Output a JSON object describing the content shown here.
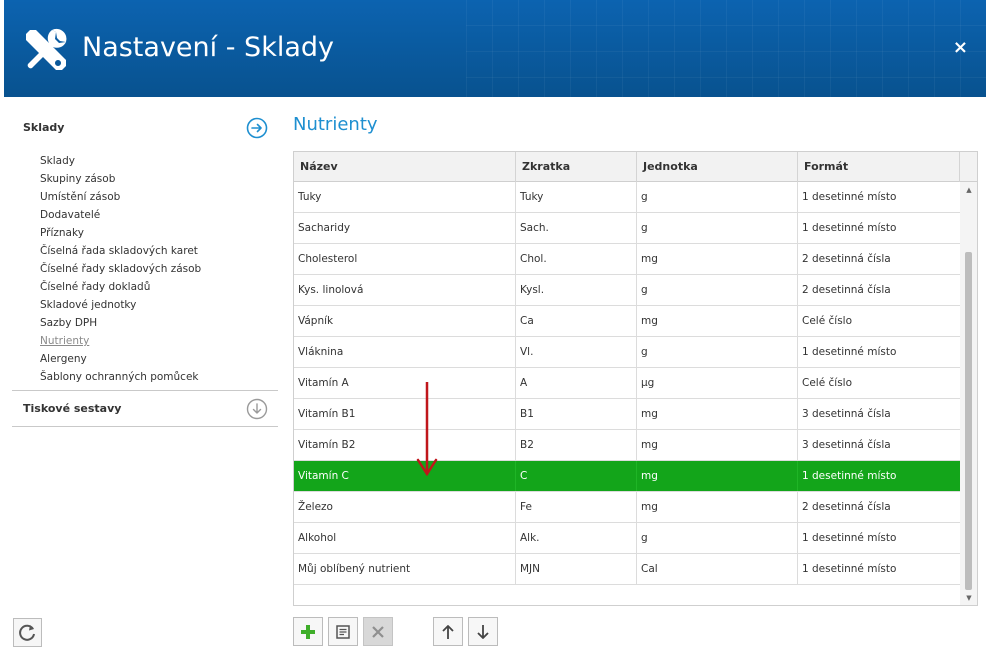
{
  "window": {
    "title": "Nastavení - Sklady",
    "close_label": "×"
  },
  "sidebar": {
    "section1": {
      "label": "Sklady"
    },
    "items": [
      {
        "label": "Sklady"
      },
      {
        "label": "Skupiny zásob"
      },
      {
        "label": "Umístění zásob"
      },
      {
        "label": "Dodavatelé"
      },
      {
        "label": "Příznaky"
      },
      {
        "label": "Číselná řada skladových karet"
      },
      {
        "label": "Číselné řady skladových zásob"
      },
      {
        "label": "Číselné řady dokladů"
      },
      {
        "label": "Skladové jednotky"
      },
      {
        "label": "Sazby DPH"
      },
      {
        "label": "Nutrienty",
        "active": true
      },
      {
        "label": "Alergeny"
      },
      {
        "label": "Šablony ochranných pomůcek"
      }
    ],
    "section2": {
      "label": "Tiskové sestavy"
    }
  },
  "main": {
    "title": "Nutrienty",
    "columns": [
      "Název",
      "Zkratka",
      "Jednotka",
      "Formát"
    ],
    "rows": [
      {
        "name": "Tuky",
        "abbr": "Tuky",
        "unit": "g",
        "format": "1 desetinné místo"
      },
      {
        "name": "Sacharidy",
        "abbr": "Sach.",
        "unit": "g",
        "format": "1 desetinné místo"
      },
      {
        "name": "Cholesterol",
        "abbr": "Chol.",
        "unit": "mg",
        "format": "2 desetinná čísla"
      },
      {
        "name": "Kys. linolová",
        "abbr": "Kysl.",
        "unit": "g",
        "format": "2 desetinná čísla"
      },
      {
        "name": "Vápník",
        "abbr": "Ca",
        "unit": "mg",
        "format": "Celé číslo"
      },
      {
        "name": "Vláknina",
        "abbr": "Vl.",
        "unit": "g",
        "format": "1 desetinné místo"
      },
      {
        "name": "Vitamín A",
        "abbr": "A",
        "unit": "μg",
        "format": "Celé číslo"
      },
      {
        "name": "Vitamín B1",
        "abbr": "B1",
        "unit": "mg",
        "format": "3 desetinná čísla"
      },
      {
        "name": "Vitamín B2",
        "abbr": "B2",
        "unit": "mg",
        "format": "3 desetinná čísla"
      },
      {
        "name": "Vitamín C",
        "abbr": "C",
        "unit": "mg",
        "format": "1 desetinné místo",
        "selected": true
      },
      {
        "name": "Železo",
        "abbr": "Fe",
        "unit": "mg",
        "format": "2 desetinná čísla"
      },
      {
        "name": "Alkohol",
        "abbr": "Alk.",
        "unit": "g",
        "format": "1 desetinné místo"
      },
      {
        "name": "Můj oblíbený nutrient",
        "abbr": "MJN",
        "unit": "Cal",
        "format": "1 desetinné místo"
      }
    ]
  },
  "toolbar": {
    "buttons": [
      "add-icon",
      "edit-icon",
      "delete-icon",
      "move-up-icon",
      "move-down-icon"
    ]
  },
  "colors": {
    "header": "#0a5aa3",
    "accent": "#1e8fd0",
    "selected_row": "#13a51a",
    "add_icon": "#3fae2a",
    "arrow": "#c0161b"
  }
}
